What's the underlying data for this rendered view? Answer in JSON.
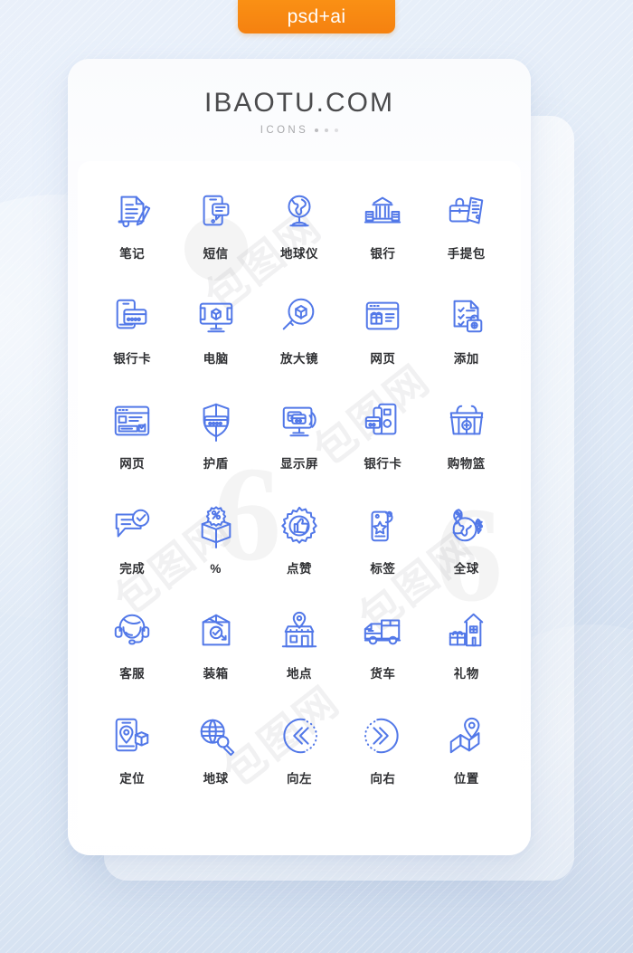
{
  "badge": {
    "label": "psd+ai"
  },
  "header": {
    "title": "IBAOTU.COM",
    "subtitle": "ICONS"
  },
  "watermark": {
    "text": "包图网",
    "digit": "6"
  },
  "colors": {
    "icon_stroke": "#5278e8",
    "label_text": "#2f3033",
    "badge_bg": "#f7890f",
    "card_bg": "#ffffff",
    "page_bg": "#dfe9f5"
  },
  "icons": [
    {
      "label": "笔记",
      "name": "notes-icon"
    },
    {
      "label": "短信",
      "name": "sms-icon"
    },
    {
      "label": "地球仪",
      "name": "globe-stand-icon"
    },
    {
      "label": "银行",
      "name": "bank-icon"
    },
    {
      "label": "手提包",
      "name": "handbag-icon"
    },
    {
      "label": "银行卡",
      "name": "bank-card-phone-icon"
    },
    {
      "label": "电脑",
      "name": "computer-icon"
    },
    {
      "label": "放大镜",
      "name": "magnifier-box-icon"
    },
    {
      "label": "网页",
      "name": "webpage-gift-icon"
    },
    {
      "label": "添加",
      "name": "add-document-icon"
    },
    {
      "label": "网页",
      "name": "webpage-form-icon"
    },
    {
      "label": "护盾",
      "name": "shield-icon"
    },
    {
      "label": "显示屏",
      "name": "display-screen-icon"
    },
    {
      "label": "银行卡",
      "name": "bank-card-stack-icon"
    },
    {
      "label": "购物篮",
      "name": "shopping-basket-icon"
    },
    {
      "label": "完成",
      "name": "complete-chat-icon"
    },
    {
      "label": "%",
      "name": "percent-box-icon"
    },
    {
      "label": "点赞",
      "name": "thumbs-up-icon"
    },
    {
      "label": "标签",
      "name": "tag-star-icon"
    },
    {
      "label": "全球",
      "name": "global-percent-icon"
    },
    {
      "label": "客服",
      "name": "customer-service-icon"
    },
    {
      "label": "装箱",
      "name": "packing-box-icon"
    },
    {
      "label": "地点",
      "name": "shop-location-icon"
    },
    {
      "label": "货车",
      "name": "truck-icon"
    },
    {
      "label": "礼物",
      "name": "gift-house-icon"
    },
    {
      "label": "定位",
      "name": "positioning-icon"
    },
    {
      "label": "地球",
      "name": "earth-search-icon"
    },
    {
      "label": "向左",
      "name": "arrow-left-icon"
    },
    {
      "label": "向右",
      "name": "arrow-right-icon"
    },
    {
      "label": "位置",
      "name": "map-position-icon"
    }
  ]
}
